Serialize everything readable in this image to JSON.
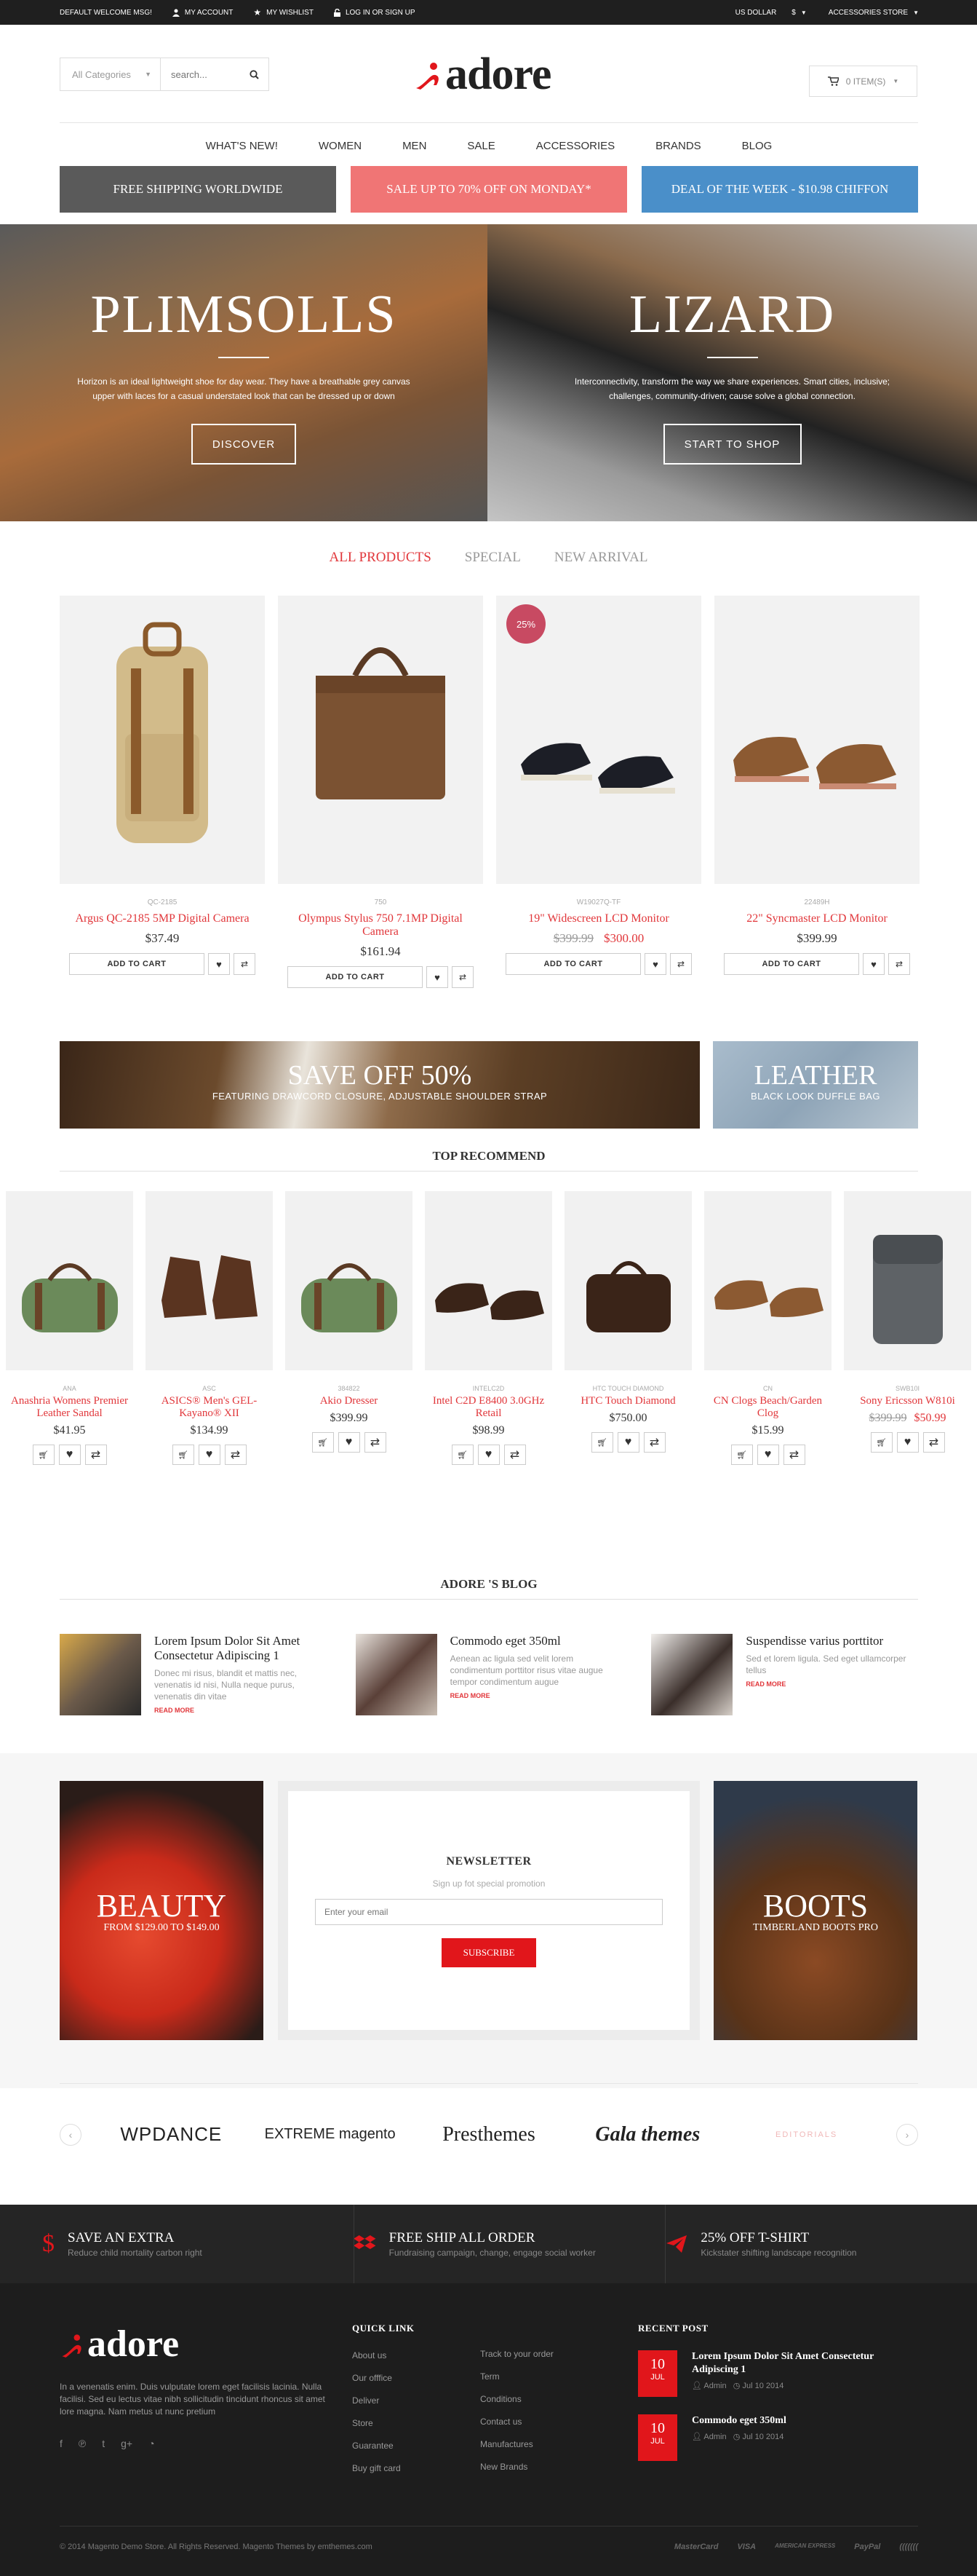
{
  "topbar": {
    "welcome": "DEFAULT WELCOME MSG!",
    "my_account": "MY ACCOUNT",
    "wishlist": "MY WISHLIST",
    "login": "LOG IN OR SIGN UP",
    "currency": "US DOLLAR",
    "currency_symbol": "$",
    "store": "ACCESSORIES STORE"
  },
  "search": {
    "category": "All Categories",
    "placeholder": "search..."
  },
  "logo": "adore",
  "cart": {
    "label": "0 ITEM(S)"
  },
  "nav": [
    "WHAT'S NEW!",
    "WOMEN",
    "MEN",
    "SALE",
    "ACCESSORIES",
    "BRANDS",
    "BLOG"
  ],
  "promos": [
    {
      "text": "FREE SHIPPING WORLDWIDE",
      "color": "#5a5a5a"
    },
    {
      "text": "SALE UP TO 70% OFF ON MONDAY*",
      "color": "#f07575"
    },
    {
      "text": "DEAL OF THE WEEK - $10.98 CHIFFON",
      "color": "#4a8fc9"
    }
  ],
  "hero": [
    {
      "title": "PLIMSOLLS",
      "text": "Horizon is an ideal lightweight shoe for day wear. They have a breathable grey canvas upper with laces for a casual understated look that can be dressed up or down",
      "button": "DISCOVER"
    },
    {
      "title": "LIZARD",
      "text": "Interconnectivity, transform the way we share experiences. Smart cities, inclusive; challenges, community-driven; cause solve a global connection.",
      "button": "START TO SHOP"
    }
  ],
  "tabs": [
    "ALL PRODUCTS",
    "SPECIAL",
    "NEW ARRIVAL"
  ],
  "products": [
    {
      "code": "QC-2185",
      "name": "Argus QC-2185 5MP Digital Camera",
      "price": "$37.49",
      "old_price": "",
      "badge": "",
      "add": "ADD TO CART"
    },
    {
      "code": "750",
      "name": "Olympus Stylus 750 7.1MP Digital Camera",
      "price": "$161.94",
      "old_price": "",
      "badge": "",
      "add": "ADD TO CART"
    },
    {
      "code": "W19027Q-TF",
      "name": "19\" Widescreen LCD Monitor",
      "price": "$300.00",
      "old_price": "$399.99",
      "badge": "25%",
      "add": "ADD TO CART"
    },
    {
      "code": "22489H",
      "name": "22\" Syncmaster LCD Monitor",
      "price": "$399.99",
      "old_price": "",
      "badge": "",
      "add": "ADD TO CART"
    }
  ],
  "banners": [
    {
      "title": "SAVE OFF 50%",
      "sub": "FEATURING DRAWCORD CLOSURE, ADJUSTABLE SHOULDER STRAP"
    },
    {
      "title": "LEATHER",
      "sub": "BLACK LOOK DUFFLE BAG"
    }
  ],
  "top_recommend": {
    "title": "TOP RECOMMEND",
    "items": [
      {
        "code": "ANA",
        "name": "Anashria Womens Premier Leather Sandal",
        "price": "$41.95",
        "old_price": ""
      },
      {
        "code": "ASC",
        "name": "ASICS® Men's GEL-Kayano® XII",
        "price": "$134.99",
        "old_price": ""
      },
      {
        "code": "384822",
        "name": "Akio Dresser",
        "price": "$399.99",
        "old_price": ""
      },
      {
        "code": "INTELC2D",
        "name": "Intel C2D E8400 3.0GHz Retail",
        "price": "$98.99",
        "old_price": ""
      },
      {
        "code": "HTC TOUCH DIAMOND",
        "name": "HTC Touch Diamond",
        "price": "$750.00",
        "old_price": ""
      },
      {
        "code": "CN",
        "name": "CN Clogs Beach/Garden Clog",
        "price": "$15.99",
        "old_price": ""
      },
      {
        "code": "SWB10I",
        "name": "Sony Ericsson W810i",
        "price": "$50.99",
        "old_price": "$399.99"
      }
    ]
  },
  "blog": {
    "title": "ADORE 'S BLOG",
    "posts": [
      {
        "title": "Lorem Ipsum Dolor Sit Amet Consectetur Adipiscing 1",
        "excerpt": "Donec mi risus, blandit et mattis nec, venenatis id nisi, Nulla neque purus, venenatis din vitae",
        "more": "READ MORE"
      },
      {
        "title": "Commodo eget 350ml",
        "excerpt": "Aenean ac ligula sed velit lorem condimentum porttitor risus vitae augue tempor condimentum augue",
        "more": "READ MORE"
      },
      {
        "title": "Suspendisse varius porttitor",
        "excerpt": "Sed et lorem ligula. Sed eget ullamcorper tellus",
        "more": "READ MORE"
      }
    ]
  },
  "beauty": {
    "title": "BEAUTY",
    "sub": "FROM $129.00 TO $149.00"
  },
  "boots": {
    "title": "BOOTS",
    "sub": "TIMBERLAND BOOTS PRO"
  },
  "newsletter": {
    "title": "NEWSLETTER",
    "sub": "Sign up fot special promotion",
    "placeholder": "Enter your email",
    "button": "SUBSCRIBE"
  },
  "brands": [
    "WPDANCE",
    "EXTREME magento",
    "Presthemes",
    "Gala themes",
    "EDITORIALS"
  ],
  "features": [
    {
      "title": "SAVE AN EXTRA",
      "desc": "Reduce child mortality carbon right",
      "icon": "dollar-icon"
    },
    {
      "title": "FREE SHIP ALL ORDER",
      "desc": "Fundraising campaign, change, engage social worker",
      "icon": "dropbox-icon"
    },
    {
      "title": "25% OFF T-SHIRT",
      "desc": "Kickstater shifting landscape recognition",
      "icon": "paper-plane-icon"
    }
  ],
  "footer": {
    "about": "In a venenatis enim. Duis vulputate lorem eget facilisis lacinia. Nulla facilisi. Sed eu lectus vitae nibh sollicitudin tincidunt rhoncus sit amet lore magna. Nam metus ut nunc pretium",
    "quick_link_title": "QUICK LINK",
    "links_a": [
      "About us",
      "Our offfice",
      "Deliver",
      "Store",
      "Guarantee",
      "Buy gift card"
    ],
    "links_b": [
      "Track to your order",
      "Term",
      "Conditions",
      "Contact us",
      "Manufactures",
      "New Brands"
    ],
    "recent_title": "RECENT POST",
    "recent": [
      {
        "day": "10",
        "month": "JUL",
        "title": "Lorem Ipsum Dolor Sit Amet Consectetur Adipiscing 1",
        "author": "Admin",
        "date": "Jul 10 2014"
      },
      {
        "day": "10",
        "month": "JUL",
        "title": "Commodo eget 350ml",
        "author": "Admin",
        "date": "Jul 10 2014"
      }
    ],
    "copyright": "© 2014 Magento Demo Store. All Rights Reserved. Magento Themes by emthemes.com",
    "payments": [
      "MasterCard",
      "VISA",
      "AMERICAN EXPRESS",
      "PayPal",
      "((((((("
    ]
  },
  "colors": {
    "accent": "#e1363a",
    "dark": "#1d1d1d"
  }
}
